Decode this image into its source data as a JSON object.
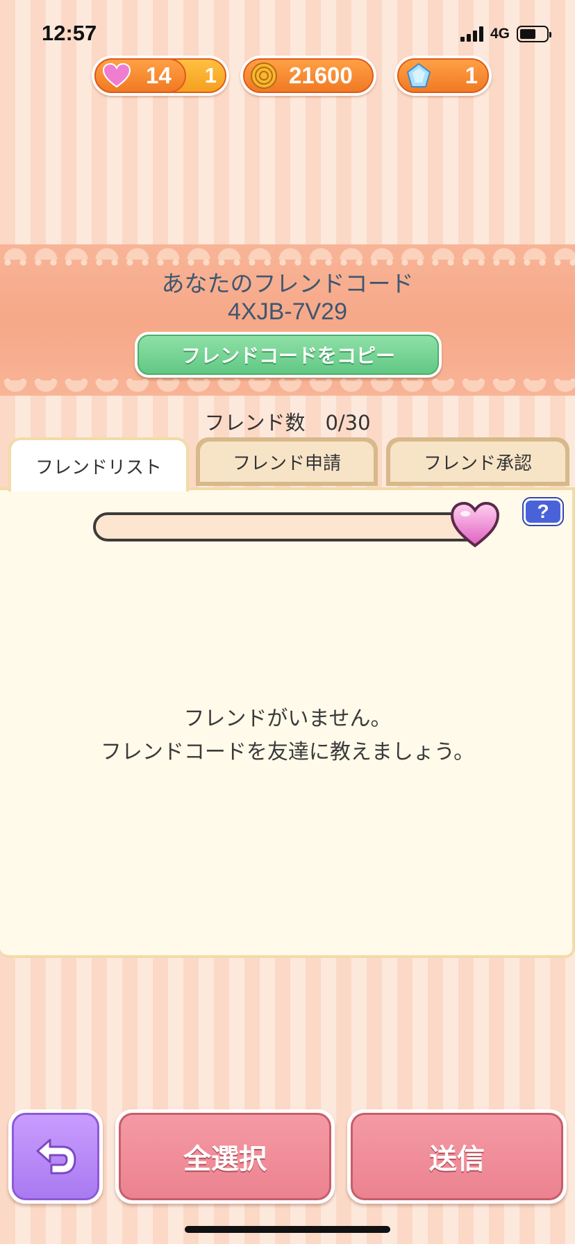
{
  "status_bar": {
    "time": "12:57",
    "network": "4G"
  },
  "currencies": {
    "hearts": {
      "icon": "heart-icon",
      "value": "14",
      "extra": "1"
    },
    "coins": {
      "icon": "coin-icon",
      "value": "21600"
    },
    "gems": {
      "icon": "gem-icon",
      "value": "1"
    }
  },
  "friend_code": {
    "title": "あなたのフレンドコード",
    "code": "4XJB-7V29",
    "copy_button": "フレンドコードをコピー"
  },
  "friend_count": "フレンド数　0/30",
  "tabs": [
    {
      "label": "フレンドリスト",
      "active": true
    },
    {
      "label": "フレンド申請",
      "active": false
    },
    {
      "label": "フレンド承認",
      "active": false
    }
  ],
  "help_label": "?",
  "empty_message": {
    "line1": "フレンドがいません。",
    "line2": "フレンドコードを友達に教えましょう。"
  },
  "buttons": {
    "select_all": "全選択",
    "send": "送信"
  },
  "colors": {
    "accent_orange": "#f07a24",
    "copy_green": "#62c884",
    "button_pink": "#ec8290",
    "back_purple": "#a97af0",
    "help_blue": "#4a62d8"
  }
}
